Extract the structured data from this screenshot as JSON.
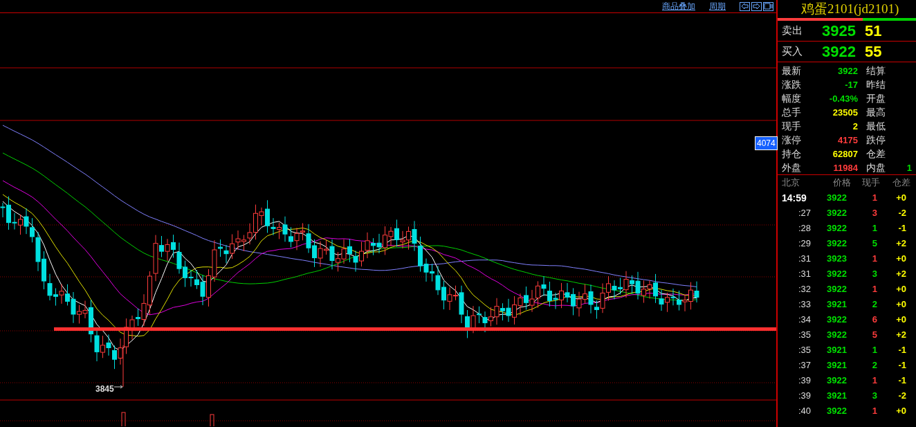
{
  "toolbar": {
    "links": [
      "商品叠加",
      "周期"
    ]
  },
  "chart": {
    "price_tag": "4074",
    "low_label": "3845"
  },
  "quote": {
    "title": "鸡蛋2101(jd2101)",
    "ask": {
      "label": "卖出",
      "price": "3925",
      "volume": "51"
    },
    "bid": {
      "label": "买入",
      "price": "3922",
      "volume": "55"
    },
    "stats": [
      {
        "label": "最新",
        "value": "3922",
        "color": "#00e000",
        "label2": "结算"
      },
      {
        "label": "涨跌",
        "value": "-17",
        "color": "#00e000",
        "label2": "昨结"
      },
      {
        "label": "幅度",
        "value": "-0.43%",
        "color": "#00e000",
        "label2": "开盘"
      },
      {
        "label": "总手",
        "value": "23505",
        "color": "#ffff00",
        "label2": "最高"
      },
      {
        "label": "现手",
        "value": "2",
        "color": "#ffff00",
        "label2": "最低"
      },
      {
        "label": "涨停",
        "value": "4175",
        "color": "#ff3c3c",
        "label2": "跌停"
      },
      {
        "label": "持仓",
        "value": "62807",
        "color": "#ffff00",
        "label2": "仓差"
      },
      {
        "label": "外盘",
        "value": "11984",
        "color": "#ff3c3c",
        "label2": "内盘",
        "value2": "1"
      }
    ]
  },
  "ticks": {
    "columns": [
      "北京",
      "价格",
      "现手",
      "仓差"
    ],
    "rows": [
      {
        "time": "14:59",
        "price": "3922",
        "volume": "1",
        "color": "#ff3c3c",
        "change": "+0"
      },
      {
        "time": ":27",
        "price": "3922",
        "volume": "3",
        "color": "#ff3c3c",
        "change": "-2"
      },
      {
        "time": ":28",
        "price": "3922",
        "volume": "1",
        "color": "#00e000",
        "change": "-1"
      },
      {
        "time": ":29",
        "price": "3922",
        "volume": "5",
        "color": "#00e000",
        "change": "+2"
      },
      {
        "time": ":31",
        "price": "3923",
        "volume": "1",
        "color": "#ff3c3c",
        "change": "+0"
      },
      {
        "time": ":31",
        "price": "3922",
        "volume": "3",
        "color": "#00e000",
        "change": "+2"
      },
      {
        "time": ":32",
        "price": "3922",
        "volume": "1",
        "color": "#ff3c3c",
        "change": "+0"
      },
      {
        "time": ":33",
        "price": "3921",
        "volume": "2",
        "color": "#00e000",
        "change": "+0"
      },
      {
        "time": ":34",
        "price": "3922",
        "volume": "6",
        "color": "#ff3c3c",
        "change": "+0"
      },
      {
        "time": ":35",
        "price": "3922",
        "volume": "5",
        "color": "#ff3c3c",
        "change": "+2"
      },
      {
        "time": ":35",
        "price": "3921",
        "volume": "1",
        "color": "#00e000",
        "change": "-1"
      },
      {
        "time": ":37",
        "price": "3921",
        "volume": "2",
        "color": "#00e000",
        "change": "-1"
      },
      {
        "time": ":39",
        "price": "3922",
        "volume": "1",
        "color": "#ff3c3c",
        "change": "-1"
      },
      {
        "time": ":39",
        "price": "3921",
        "volume": "3",
        "color": "#00e000",
        "change": "-2"
      },
      {
        "time": ":40",
        "price": "3922",
        "volume": "1",
        "color": "#ff3c3c",
        "change": "+0"
      }
    ]
  }
}
